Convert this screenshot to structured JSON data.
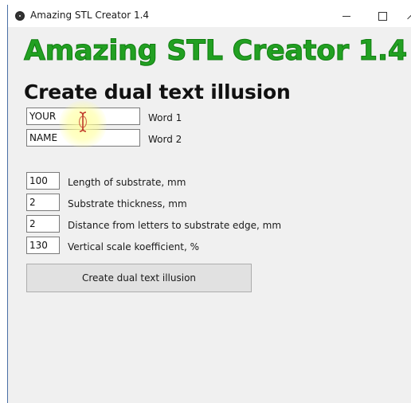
{
  "window": {
    "title": "Amazing STL Creator 1.4"
  },
  "header": {
    "title": "Amazing STL Creator 1.4",
    "subtitle": "Create dual text illusion"
  },
  "words": [
    {
      "value": "YOUR",
      "label": "Word 1"
    },
    {
      "value": "NAME",
      "label": "Word 2"
    }
  ],
  "params": [
    {
      "value": "100",
      "label": "Length of substrate, mm"
    },
    {
      "value": "2",
      "label": "Substrate thickness, mm"
    },
    {
      "value": "2",
      "label": "Distance from letters to substrate edge, mm"
    },
    {
      "value": "130",
      "label": "Vertical scale koefficient, %"
    }
  ],
  "action": {
    "label": "Create dual text illusion"
  },
  "colors": {
    "heading_green": "#22a022",
    "window_bg": "#f0f0f0"
  }
}
